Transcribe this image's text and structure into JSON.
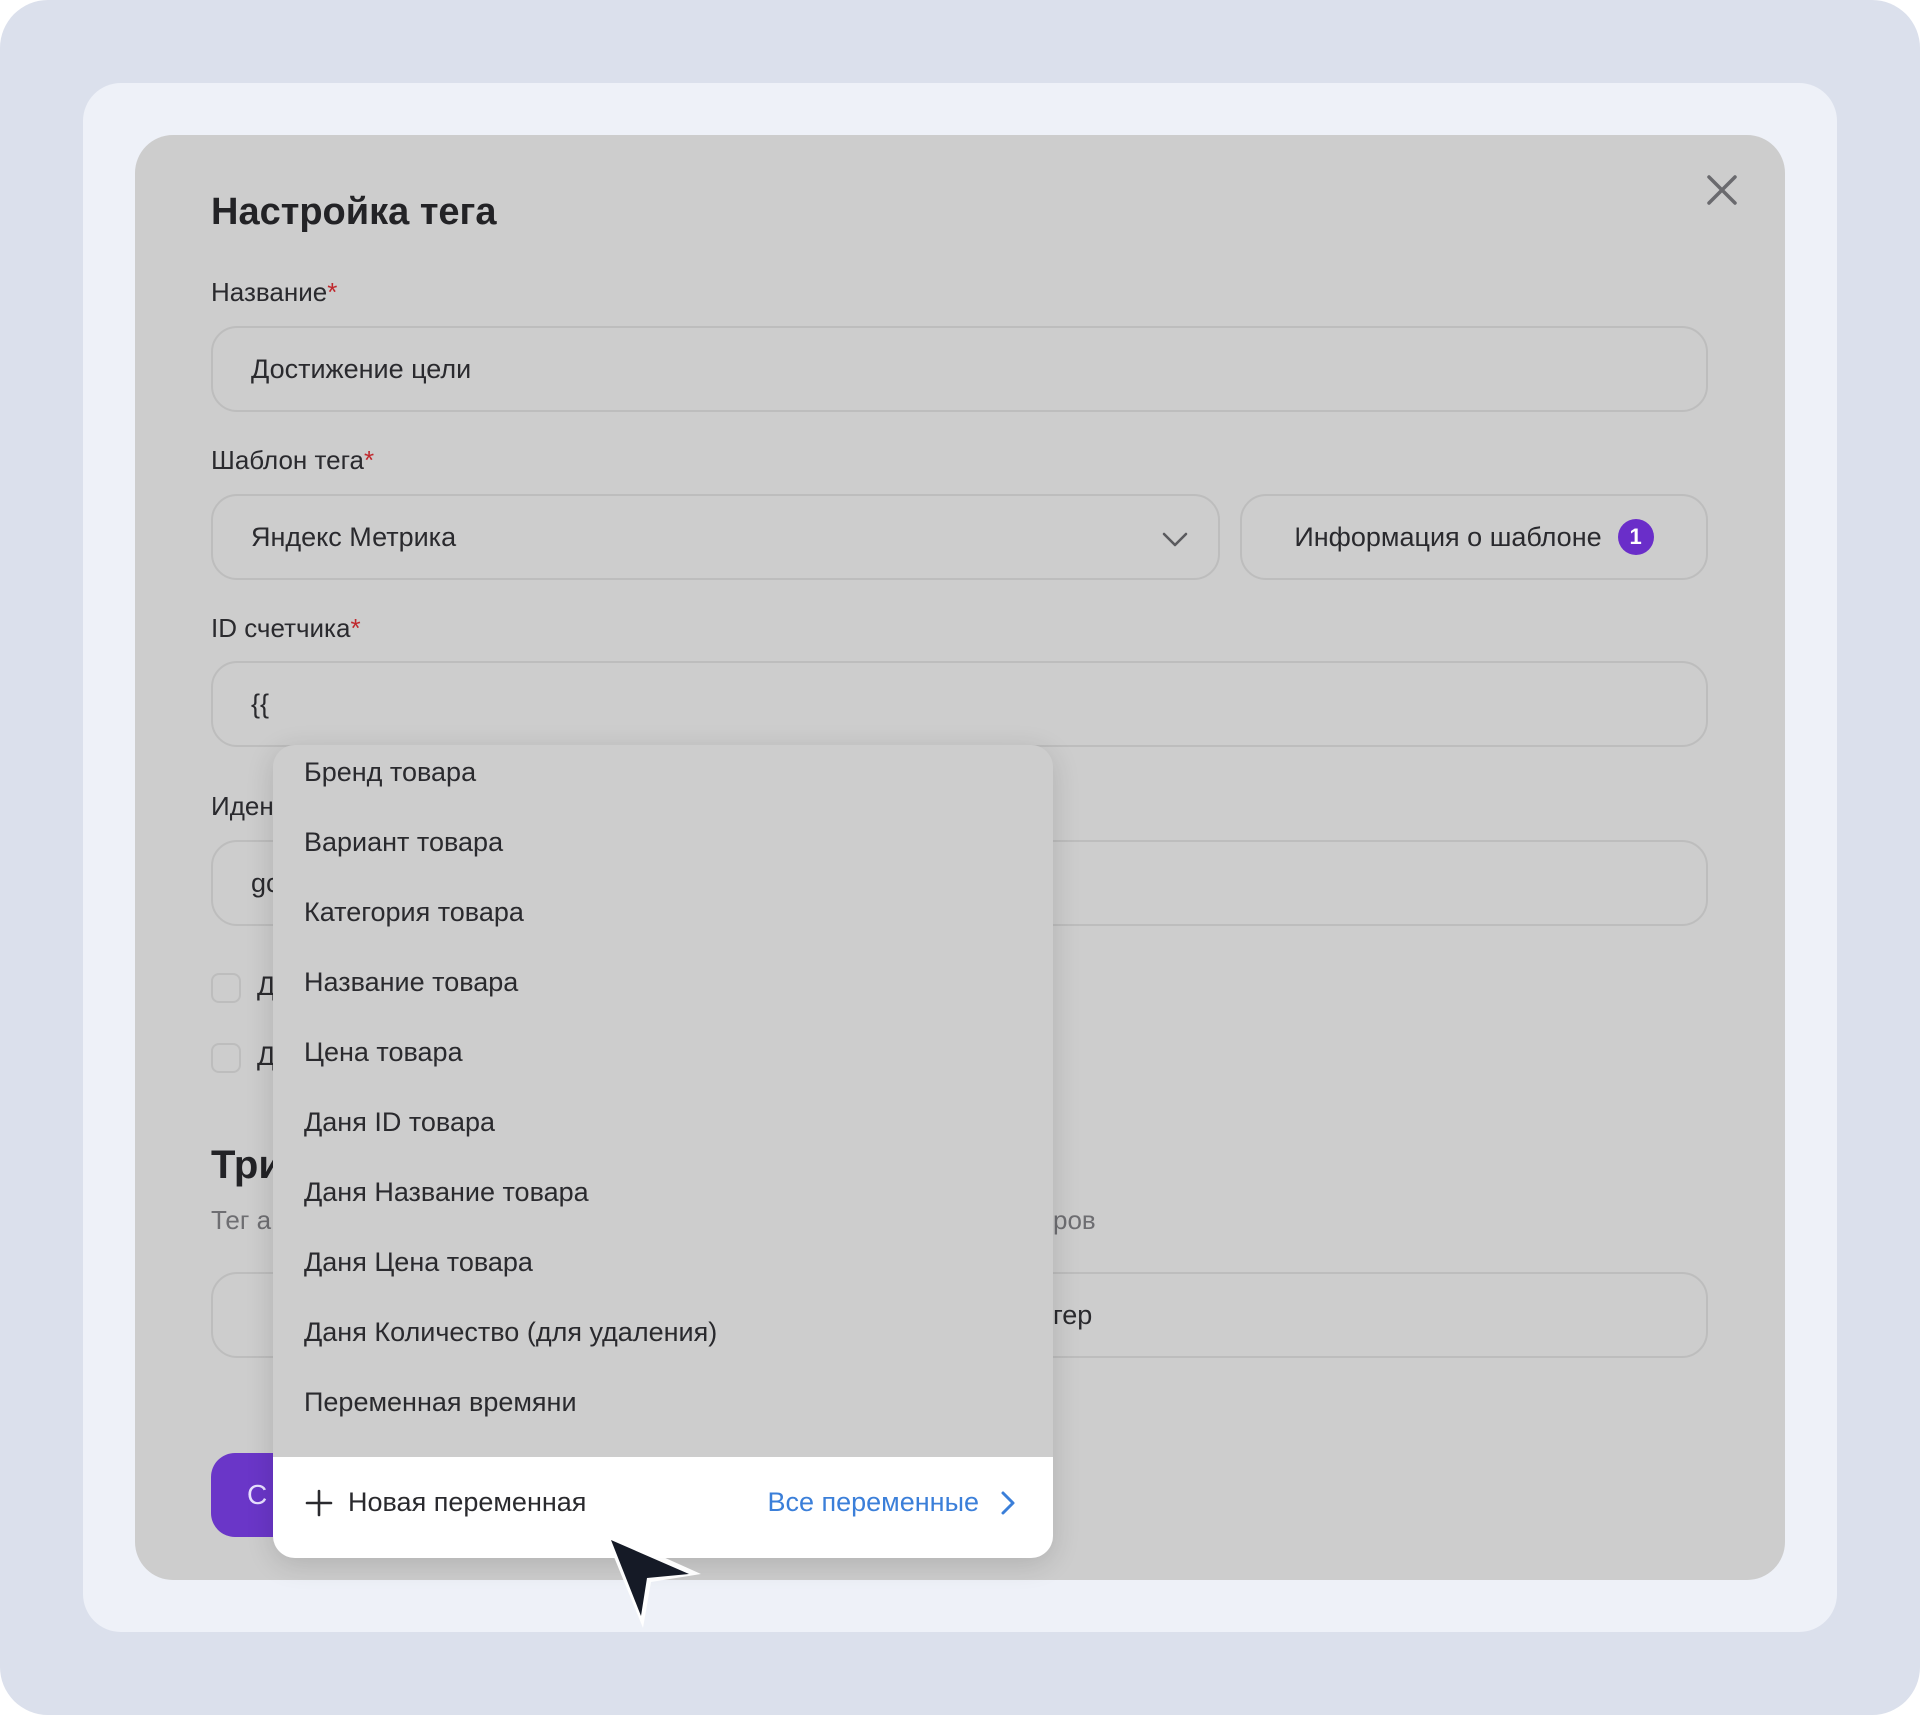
{
  "dialog": {
    "title": "Настройка тега",
    "close_icon": "close-icon",
    "name_field": {
      "label": "Название",
      "required_mark": "*",
      "value": "Достижение цели"
    },
    "template_field": {
      "label": "Шаблон тега",
      "required_mark": "*",
      "value": "Яндекс Метрика",
      "icon": "chevron-down-icon"
    },
    "template_info_button": {
      "label": "Информация о шаблоне",
      "badge": "1"
    },
    "counter_id_field": {
      "label": "ID счетчика",
      "required_mark": "*",
      "value": "{{"
    },
    "partial_texts": {
      "identifier_label": "Иден",
      "identifier_value": "gc",
      "checkbox1_label": "Д",
      "checkbox2_label": "Д",
      "section_title": "Три",
      "section_sub_left": "Тег а",
      "section_sub_right": "ров",
      "trigger_field_right": "гер",
      "submit_label": "С"
    }
  },
  "dropdown": {
    "items": [
      "Бренд товара",
      "Вариант товара",
      "Категория товара",
      "Название товара",
      "Цена товара",
      "Даня ID товара",
      "Даня Название товара",
      "Даня Цена товара",
      "Даня Количество (для удаления)",
      "Переменная времяни"
    ],
    "footer": {
      "new_variable": "Новая переменная",
      "all_variables": "Все переменные"
    }
  },
  "colors": {
    "accent": "#6a2ec9",
    "link": "#3b7fd9",
    "required": "#c0282d",
    "overlay": "#cdcdcd"
  }
}
